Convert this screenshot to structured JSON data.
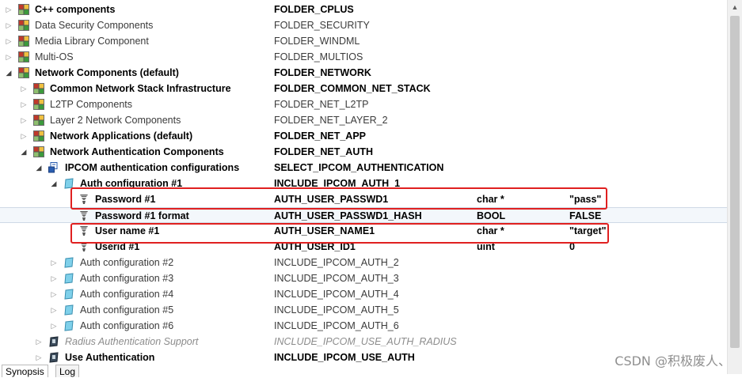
{
  "rows": [
    {
      "label": "C++ components",
      "macro": "FOLDER_CPLUS",
      "type": "",
      "value": "",
      "bold": true,
      "dim": false,
      "indent": 0,
      "toggle": "closed",
      "icon": "folder-icon",
      "selected": false
    },
    {
      "label": "Data Security Components",
      "macro": "FOLDER_SECURITY",
      "type": "",
      "value": "",
      "bold": false,
      "dim": false,
      "indent": 0,
      "toggle": "closed",
      "icon": "folder-icon",
      "selected": false
    },
    {
      "label": "Media Library Component",
      "macro": "FOLDER_WINDML",
      "type": "",
      "value": "",
      "bold": false,
      "dim": false,
      "indent": 0,
      "toggle": "closed",
      "icon": "folder-icon",
      "selected": false
    },
    {
      "label": "Multi-OS",
      "macro": "FOLDER_MULTIOS",
      "type": "",
      "value": "",
      "bold": false,
      "dim": false,
      "indent": 0,
      "toggle": "closed",
      "icon": "folder-icon",
      "selected": false
    },
    {
      "label": "Network Components (default)",
      "macro": "FOLDER_NETWORK",
      "type": "",
      "value": "",
      "bold": true,
      "dim": false,
      "indent": 0,
      "toggle": "open",
      "icon": "folder-icon",
      "selected": false
    },
    {
      "label": "Common Network Stack Infrastructure",
      "macro": "FOLDER_COMMON_NET_STACK",
      "type": "",
      "value": "",
      "bold": true,
      "dim": false,
      "indent": 1,
      "toggle": "closed",
      "icon": "folder-icon",
      "selected": false
    },
    {
      "label": "L2TP Components",
      "macro": "FOLDER_NET_L2TP",
      "type": "",
      "value": "",
      "bold": false,
      "dim": false,
      "indent": 1,
      "toggle": "closed",
      "icon": "folder-icon",
      "selected": false
    },
    {
      "label": "Layer 2 Network Components",
      "macro": "FOLDER_NET_LAYER_2",
      "type": "",
      "value": "",
      "bold": false,
      "dim": false,
      "indent": 1,
      "toggle": "closed",
      "icon": "folder-icon",
      "selected": false
    },
    {
      "label": "Network Applications (default)",
      "macro": "FOLDER_NET_APP",
      "type": "",
      "value": "",
      "bold": true,
      "dim": false,
      "indent": 1,
      "toggle": "closed",
      "icon": "folder-icon",
      "selected": false
    },
    {
      "label": "Network Authentication Components",
      "macro": "FOLDER_NET_AUTH",
      "type": "",
      "value": "",
      "bold": true,
      "dim": false,
      "indent": 1,
      "toggle": "open",
      "icon": "folder-icon",
      "selected": false
    },
    {
      "label": "IPCOM authentication configurations",
      "macro": "SELECT_IPCOM_AUTHENTICATION",
      "type": "",
      "value": "",
      "bold": true,
      "dim": false,
      "indent": 2,
      "toggle": "open",
      "icon": "selection-icon",
      "selected": false
    },
    {
      "label": "Auth configuration #1",
      "macro": "INCLUDE_IPCOM_AUTH_1",
      "type": "",
      "value": "",
      "bold": true,
      "dim": false,
      "indent": 3,
      "toggle": "open",
      "icon": "component-icon",
      "selected": false
    },
    {
      "label": "Password #1",
      "macro": "AUTH_USER_PASSWD1",
      "type": "char *",
      "value": "\"pass\"",
      "bold": true,
      "dim": false,
      "indent": 4,
      "toggle": "none",
      "icon": "parameter-icon",
      "selected": false
    },
    {
      "label": "Password #1 format",
      "macro": "AUTH_USER_PASSWD1_HASH",
      "type": "BOOL",
      "value": "FALSE",
      "bold": true,
      "dim": false,
      "indent": 4,
      "toggle": "none",
      "icon": "parameter-icon",
      "selected": true
    },
    {
      "label": "User name #1",
      "macro": "AUTH_USER_NAME1",
      "type": "char *",
      "value": "\"target\"",
      "bold": true,
      "dim": false,
      "indent": 4,
      "toggle": "none",
      "icon": "parameter-icon",
      "selected": false
    },
    {
      "label": "Userid #1",
      "macro": "AUTH_USER_ID1",
      "type": "uint",
      "value": "0",
      "bold": true,
      "dim": false,
      "indent": 4,
      "toggle": "none",
      "icon": "parameter-icon",
      "selected": false
    },
    {
      "label": "Auth configuration #2",
      "macro": "INCLUDE_IPCOM_AUTH_2",
      "type": "",
      "value": "",
      "bold": false,
      "dim": false,
      "indent": 3,
      "toggle": "closed",
      "icon": "component-icon",
      "selected": false
    },
    {
      "label": "Auth configuration #3",
      "macro": "INCLUDE_IPCOM_AUTH_3",
      "type": "",
      "value": "",
      "bold": false,
      "dim": false,
      "indent": 3,
      "toggle": "closed",
      "icon": "component-icon",
      "selected": false
    },
    {
      "label": "Auth configuration #4",
      "macro": "INCLUDE_IPCOM_AUTH_4",
      "type": "",
      "value": "",
      "bold": false,
      "dim": false,
      "indent": 3,
      "toggle": "closed",
      "icon": "component-icon",
      "selected": false
    },
    {
      "label": "Auth configuration #5",
      "macro": "INCLUDE_IPCOM_AUTH_5",
      "type": "",
      "value": "",
      "bold": false,
      "dim": false,
      "indent": 3,
      "toggle": "closed",
      "icon": "component-icon",
      "selected": false
    },
    {
      "label": "Auth configuration #6",
      "macro": "INCLUDE_IPCOM_AUTH_6",
      "type": "",
      "value": "",
      "bold": false,
      "dim": false,
      "indent": 3,
      "toggle": "closed",
      "icon": "component-icon",
      "selected": false
    },
    {
      "label": "Radius Authentication Support",
      "macro": "INCLUDE_IPCOM_USE_AUTH_RADIUS",
      "type": "",
      "value": "",
      "bold": false,
      "dim": true,
      "indent": 2,
      "toggle": "closed",
      "icon": "component-dark-icon",
      "selected": false
    },
    {
      "label": "Use Authentication",
      "macro": "INCLUDE_IPCOM_USE_AUTH",
      "type": "",
      "value": "",
      "bold": true,
      "dim": false,
      "indent": 2,
      "toggle": "closed",
      "icon": "component-dark-icon",
      "selected": false
    }
  ],
  "tabs": [
    {
      "label": "Synopsis",
      "active": true
    },
    {
      "label": "Log",
      "active": false
    }
  ],
  "watermark": "CSDN @积极废人、",
  "colors": {
    "highlight_box": "#e02020",
    "selected_row": "#f3f7fb",
    "folder_icon_red": "#c0392b",
    "folder_icon_green": "#3c9a3c",
    "component_icon": "#5bc0de"
  }
}
